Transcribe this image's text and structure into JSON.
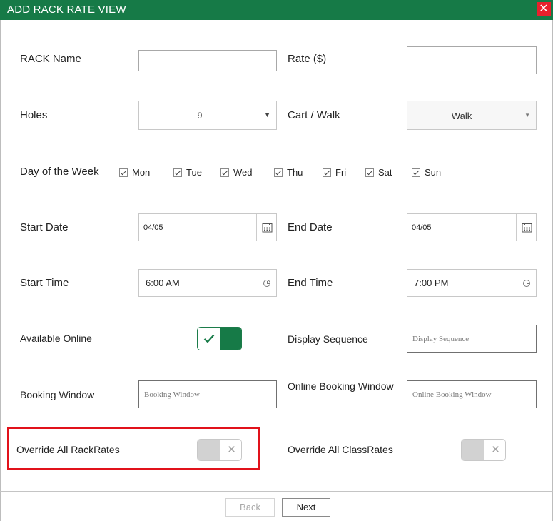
{
  "titlebar": {
    "title": "ADD RACK RATE VIEW",
    "close_glyph": "✕"
  },
  "form": {
    "rack_name": {
      "label": "RACK Name",
      "value": ""
    },
    "rate": {
      "label": "Rate ($)",
      "value": ""
    },
    "holes": {
      "label": "Holes",
      "value": "9"
    },
    "cart_walk": {
      "label": "Cart / Walk",
      "value": "Walk"
    },
    "day_of_week": {
      "label": "Day of the Week",
      "days": [
        {
          "label": "Mon",
          "checked": true
        },
        {
          "label": "Tue",
          "checked": true
        },
        {
          "label": "Wed",
          "checked": true
        },
        {
          "label": "Thu",
          "checked": true
        },
        {
          "label": "Fri",
          "checked": true
        },
        {
          "label": "Sat",
          "checked": true
        },
        {
          "label": "Sun",
          "checked": true
        }
      ]
    },
    "start_date": {
      "label": "Start Date",
      "value": "04/05"
    },
    "end_date": {
      "label": "End Date",
      "value": "04/05"
    },
    "start_time": {
      "label": "Start Time",
      "value": "6:00 AM"
    },
    "end_time": {
      "label": "End Time",
      "value": "7:00 PM"
    },
    "available_online": {
      "label": "Available Online",
      "on": true
    },
    "display_sequence": {
      "label": "Display Sequence",
      "placeholder": "Display Sequence",
      "value": ""
    },
    "booking_window": {
      "label": "Booking Window",
      "placeholder": "Booking Window",
      "value": ""
    },
    "online_booking_window": {
      "label": "Online Booking Window",
      "placeholder": "Online Booking Window",
      "value": ""
    },
    "override_rack_rates": {
      "label": "Override All RackRates",
      "on": false
    },
    "override_class_rates": {
      "label": "Override All ClassRates",
      "on": false
    }
  },
  "footer": {
    "back_label": "Back",
    "next_label": "Next"
  },
  "colors": {
    "brand_green": "#167a47",
    "close_red": "#e8202d",
    "highlight_red": "#e1121b"
  }
}
